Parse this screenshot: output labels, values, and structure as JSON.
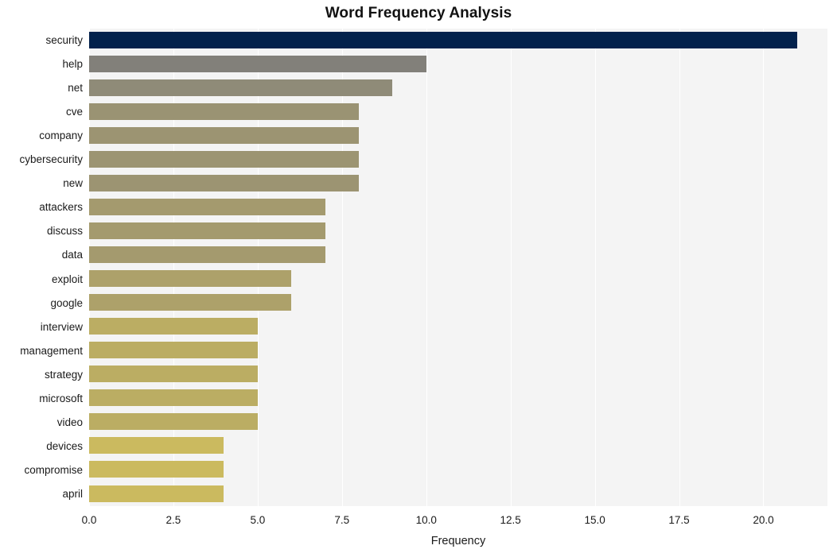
{
  "chart_data": {
    "type": "bar",
    "orientation": "horizontal",
    "title": "Word Frequency Analysis",
    "xlabel": "Frequency",
    "ylabel": "",
    "xlim": [
      0,
      21.9
    ],
    "ylim": null,
    "grid": true,
    "legend": null,
    "xticks": [
      "0.0",
      "2.5",
      "5.0",
      "7.5",
      "10.0",
      "12.5",
      "15.0",
      "17.5",
      "20.0"
    ],
    "xtick_values": [
      0,
      2.5,
      5,
      7.5,
      10,
      12.5,
      15,
      17.5,
      20
    ],
    "categories": [
      "security",
      "help",
      "net",
      "cve",
      "company",
      "cybersecurity",
      "new",
      "attackers",
      "discuss",
      "data",
      "exploit",
      "google",
      "interview",
      "management",
      "strategy",
      "microsoft",
      "video",
      "devices",
      "compromise",
      "april"
    ],
    "values": [
      21,
      10,
      9,
      8,
      8,
      8,
      8,
      7,
      7,
      7,
      6,
      6,
      5,
      5,
      5,
      5,
      5,
      4,
      4,
      4
    ],
    "bar_colors": [
      "#03224c",
      "#82807a",
      "#8f8b78",
      "#9a9373",
      "#9c9472",
      "#9c9472",
      "#9c9472",
      "#a49a6e",
      "#a49a6e",
      "#a49a6e",
      "#ada16a",
      "#ada16a",
      "#bbad63",
      "#bbad63",
      "#bbad63",
      "#bbad63",
      "#bbad63",
      "#cbba5f",
      "#cbba5f",
      "#cbba5f"
    ]
  },
  "style": {
    "plot_background": "#f4f4f4",
    "page_background": "#ffffff",
    "gridline_color": "#ffffff",
    "text_color": "#1a1a1a"
  }
}
